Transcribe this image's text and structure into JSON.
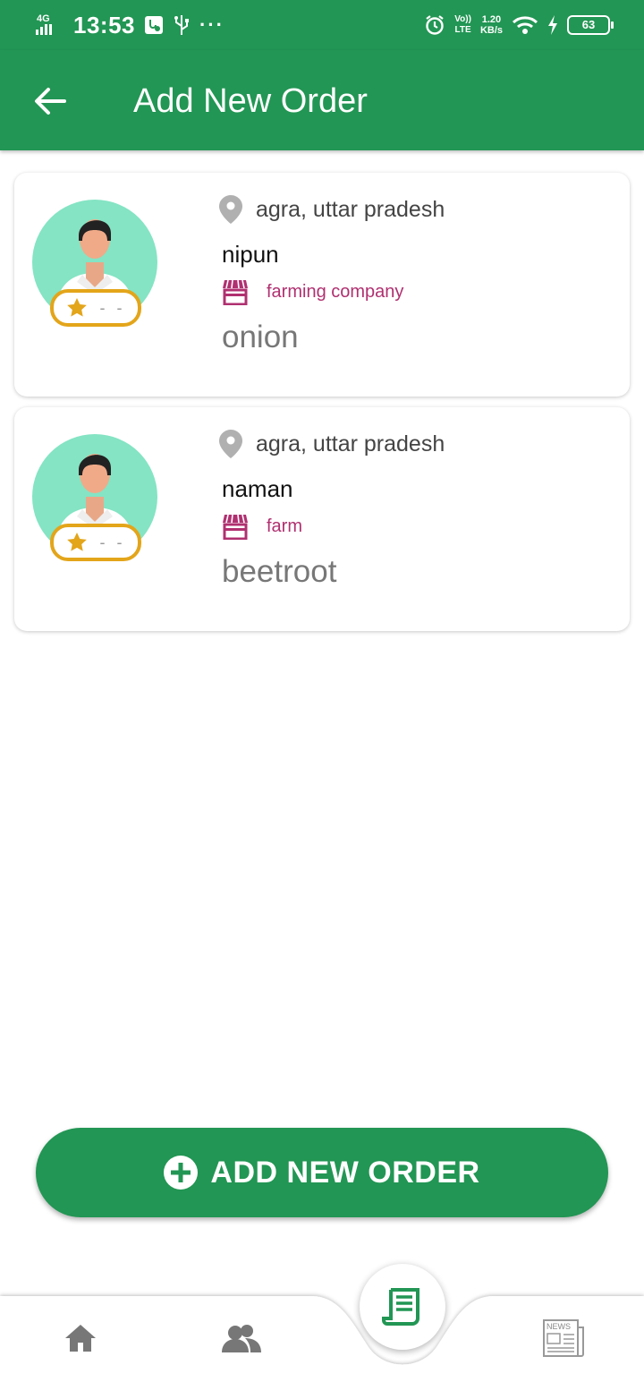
{
  "status_bar": {
    "network": "4G",
    "time": "13:53",
    "volte_top": "Vo))",
    "volte_bottom": "LTE",
    "speed_value": "1.20",
    "speed_unit": "KB/s",
    "battery": "63"
  },
  "header": {
    "title": "Add New Order",
    "back_icon": "arrow-left-icon"
  },
  "orders": [
    {
      "location": "agra, uttar pradesh",
      "name": "nipun",
      "business": "farming company",
      "crop": "onion",
      "rating": "- -"
    },
    {
      "location": "agra, uttar pradesh",
      "name": "naman",
      "business": "farm",
      "crop": "beetroot",
      "rating": "- -"
    }
  ],
  "add_button": {
    "label": "ADD NEW ORDER",
    "icon": "plus-circle-icon"
  },
  "bottom_nav": {
    "items": [
      "home-icon",
      "users-icon",
      "order-list-icon",
      "news-icon"
    ],
    "news_label": "NEWS"
  },
  "colors": {
    "primary": "#229654",
    "accent_business": "#b03070",
    "rating_border": "#e3a51a",
    "avatar_bg": "#84e4c4"
  }
}
